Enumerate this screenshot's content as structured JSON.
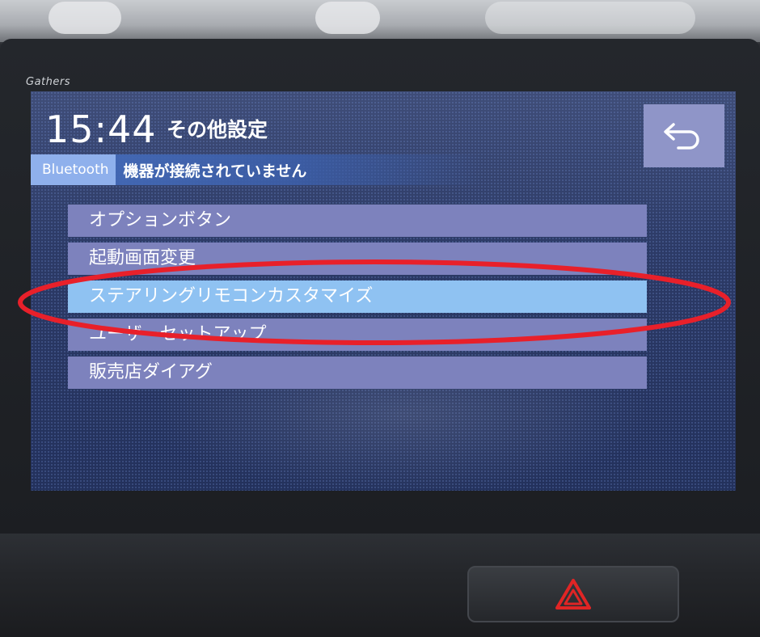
{
  "brand": "Gathers",
  "header": {
    "time": "15:44",
    "title": "その他設定"
  },
  "bluetooth": {
    "label": "Bluetooth",
    "status": "機器が接続されていません"
  },
  "menu": {
    "items": [
      {
        "label": "オプションボタン"
      },
      {
        "label": "起動画面変更"
      },
      {
        "label": "ステアリングリモコンカスタマイズ",
        "selected": true
      },
      {
        "label": "ユーザーセットアップ"
      },
      {
        "label": "販売店ダイアグ"
      }
    ]
  },
  "icons": {
    "back": "back-arrow-icon",
    "hazard": "hazard-triangle-icon"
  },
  "colors": {
    "screen_bg": "#2c3a66",
    "menu_item": "#7d82bd",
    "menu_item_selected": "#8fc2f2",
    "back_button": "#8f95c8",
    "annotation": "#e8202a",
    "hazard": "#e02525"
  }
}
